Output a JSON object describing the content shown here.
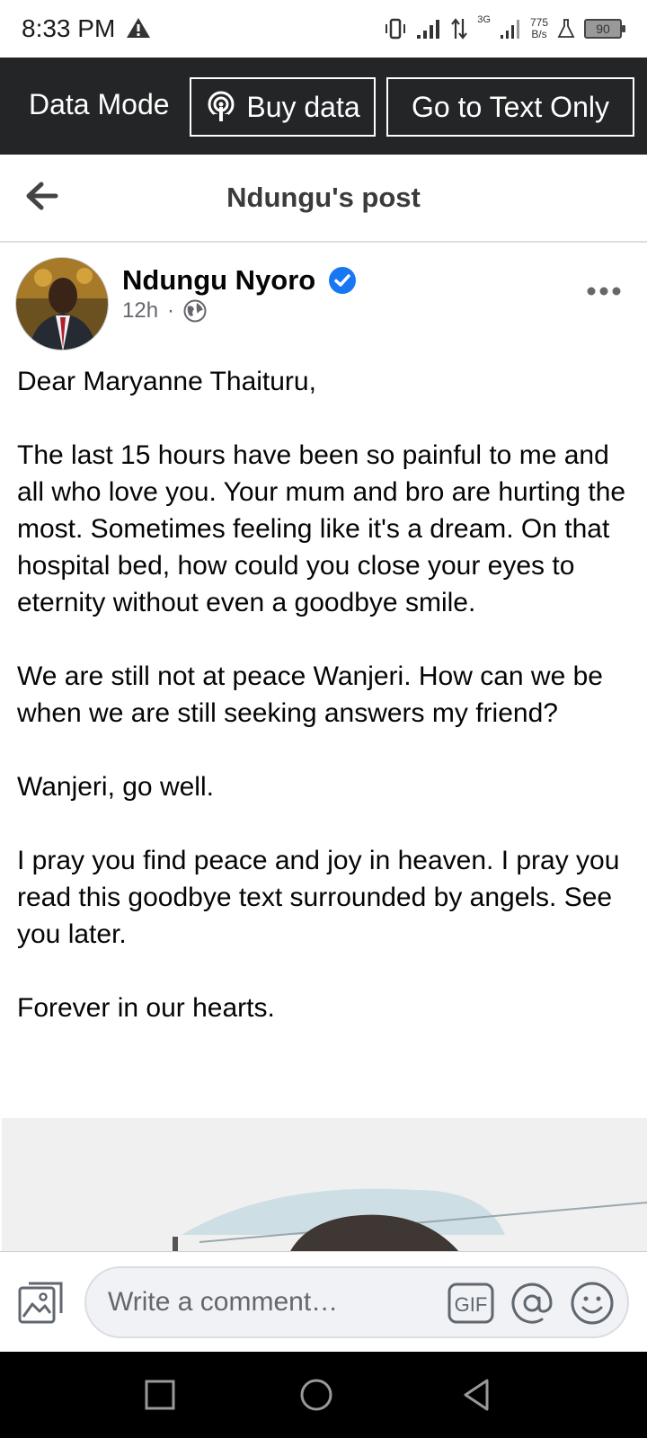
{
  "status_bar": {
    "time": "8:33 PM",
    "network_type": "3G",
    "net_speed_value": "775",
    "net_speed_unit": "B/s",
    "battery": "90",
    "icons": [
      "warning-icon",
      "vibrate-icon",
      "signal-icon",
      "data-arrows-icon",
      "signal-3g-icon",
      "lab-icon",
      "battery-icon"
    ]
  },
  "data_bar": {
    "mode_label": "Data Mode",
    "buy_label": "Buy data",
    "text_only_label": "Go to Text Only"
  },
  "nav": {
    "title": "Ndungu's post"
  },
  "post": {
    "author": "Ndungu Nyoro",
    "time": "12h",
    "separator": "·",
    "paragraphs": [
      "Dear Maryanne Thaituru,",
      "The last 15 hours have been so painful to me and all who love you. Your mum and bro are hurting the most. Sometimes feeling like it's a dream. On that hospital bed, how could you close your eyes to eternity without even a goodbye smile.",
      "We are still not at peace Wanjeri. How can we be when we are still seeking answers my friend?",
      "Wanjeri, go well.",
      "I pray you find peace and joy in heaven. I pray you read this goodbye text surrounded by angels. See you later.",
      "Forever in our hearts."
    ]
  },
  "comment_bar": {
    "placeholder": "Write a comment…"
  },
  "colors": {
    "data_bar_bg": "#242526",
    "verified_blue": "#1877f2",
    "meta_gray": "#65676b",
    "system_nav_bg": "#000000"
  }
}
